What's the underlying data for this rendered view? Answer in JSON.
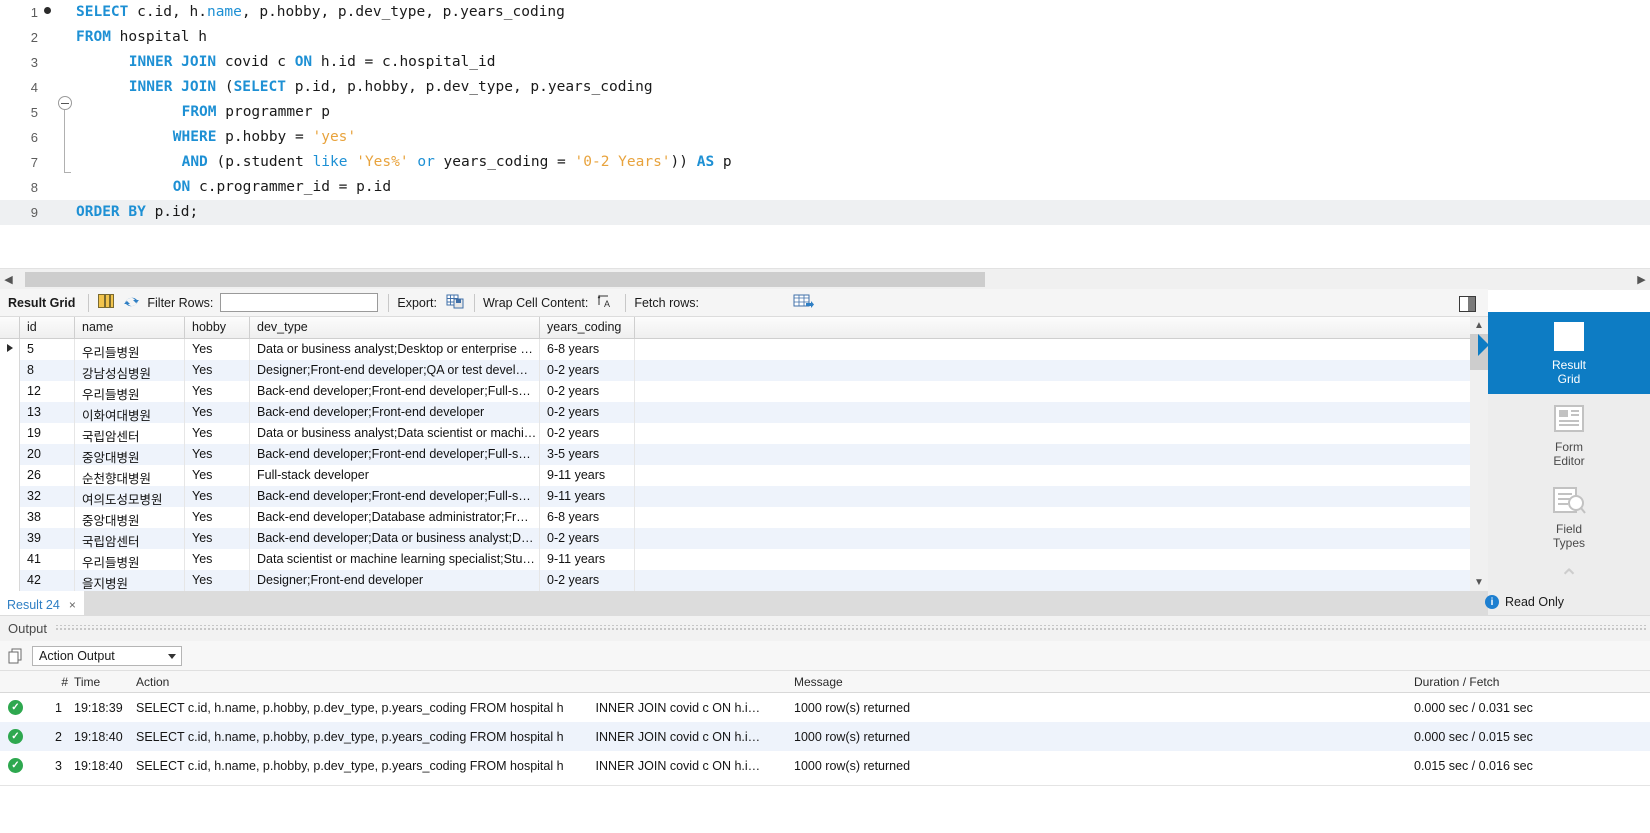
{
  "editor": {
    "lines": [
      {
        "num": "1",
        "breakpoint": true,
        "indent": 0,
        "tokens": [
          {
            "t": "SELECT",
            "c": "kw"
          },
          {
            "t": " c.id, h.",
            "c": "pl"
          },
          {
            "t": "name",
            "c": "kw2"
          },
          {
            "t": ", p.hobby, p.dev_type, p.years_coding",
            "c": "pl"
          }
        ]
      },
      {
        "num": "2",
        "breakpoint": false,
        "indent": 0,
        "tokens": [
          {
            "t": "FROM",
            "c": "kw"
          },
          {
            "t": " hospital h",
            "c": "pl"
          }
        ]
      },
      {
        "num": "3",
        "breakpoint": false,
        "indent": 6,
        "tokens": [
          {
            "t": "INNER JOIN",
            "c": "kw"
          },
          {
            "t": " covid c ",
            "c": "pl"
          },
          {
            "t": "ON",
            "c": "kw"
          },
          {
            "t": " h.id = c.hospital_id",
            "c": "pl"
          }
        ]
      },
      {
        "num": "4",
        "breakpoint": false,
        "indent": 6,
        "fold": true,
        "tokens": [
          {
            "t": "INNER JOIN",
            "c": "kw"
          },
          {
            "t": " (",
            "c": "pl"
          },
          {
            "t": "SELECT",
            "c": "kw"
          },
          {
            "t": " p.id, p.hobby, p.dev_type, p.years_coding",
            "c": "pl"
          }
        ]
      },
      {
        "num": "5",
        "breakpoint": false,
        "indent": 12,
        "tokens": [
          {
            "t": "FROM",
            "c": "kw"
          },
          {
            "t": " programmer p",
            "c": "pl"
          }
        ]
      },
      {
        "num": "6",
        "breakpoint": false,
        "indent": 11,
        "tokens": [
          {
            "t": "WHERE",
            "c": "kw"
          },
          {
            "t": " p.hobby = ",
            "c": "pl"
          },
          {
            "t": "'yes'",
            "c": "str"
          }
        ]
      },
      {
        "num": "7",
        "breakpoint": false,
        "indent": 12,
        "tokens": [
          {
            "t": "AND",
            "c": "kw"
          },
          {
            "t": " (p.student ",
            "c": "pl"
          },
          {
            "t": "like",
            "c": "kw2"
          },
          {
            "t": " ",
            "c": "pl"
          },
          {
            "t": "'Yes%'",
            "c": "str"
          },
          {
            "t": " ",
            "c": "pl"
          },
          {
            "t": "or",
            "c": "kw2"
          },
          {
            "t": " years_coding = ",
            "c": "pl"
          },
          {
            "t": "'0-2 Years'",
            "c": "str"
          },
          {
            "t": ")) ",
            "c": "pl"
          },
          {
            "t": "AS",
            "c": "kw"
          },
          {
            "t": " p",
            "c": "pl"
          }
        ]
      },
      {
        "num": "8",
        "breakpoint": false,
        "indent": 11,
        "tokens": [
          {
            "t": "ON",
            "c": "kw"
          },
          {
            "t": " c.programmer_id = p.id",
            "c": "pl"
          }
        ]
      },
      {
        "num": "9",
        "breakpoint": false,
        "indent": 0,
        "current": true,
        "tokens": [
          {
            "t": "ORDER BY",
            "c": "kw"
          },
          {
            "t": " p.id;",
            "c": "pl"
          }
        ]
      }
    ]
  },
  "result_toolbar": {
    "title": "Result Grid",
    "filter_label": "Filter Rows:",
    "filter_value": "",
    "export_label": "Export:",
    "wrap_label": "Wrap Cell Content:",
    "wrap_glyph": "↑A",
    "fetch_label": "Fetch rows:"
  },
  "grid": {
    "columns": [
      "id",
      "name",
      "hobby",
      "dev_type",
      "years_coding"
    ],
    "rows": [
      {
        "id": "5",
        "name": "우리들병원",
        "hobby": "Yes",
        "dev_type": "Data or business analyst;Desktop or enterprise …",
        "years_coding": "6-8 years",
        "selected": true
      },
      {
        "id": "8",
        "name": "강남성심병원",
        "hobby": "Yes",
        "dev_type": "Designer;Front-end developer;QA or test devel…",
        "years_coding": "0-2 years"
      },
      {
        "id": "12",
        "name": "우리들병원",
        "hobby": "Yes",
        "dev_type": "Back-end developer;Front-end developer;Full-s…",
        "years_coding": "0-2 years"
      },
      {
        "id": "13",
        "name": "이화여대병원",
        "hobby": "Yes",
        "dev_type": "Back-end developer;Front-end developer",
        "years_coding": "0-2 years"
      },
      {
        "id": "19",
        "name": "국립암센터",
        "hobby": "Yes",
        "dev_type": "Data or business analyst;Data scientist or machi…",
        "years_coding": "0-2 years"
      },
      {
        "id": "20",
        "name": "중앙대병원",
        "hobby": "Yes",
        "dev_type": "Back-end developer;Front-end developer;Full-s…",
        "years_coding": "3-5 years"
      },
      {
        "id": "26",
        "name": "순천향대병원",
        "hobby": "Yes",
        "dev_type": "Full-stack developer",
        "years_coding": "9-11 years"
      },
      {
        "id": "32",
        "name": "여의도성모병원",
        "hobby": "Yes",
        "dev_type": "Back-end developer;Front-end developer;Full-s…",
        "years_coding": "9-11 years"
      },
      {
        "id": "38",
        "name": "중앙대병원",
        "hobby": "Yes",
        "dev_type": "Back-end developer;Database administrator;Fr…",
        "years_coding": "6-8 years"
      },
      {
        "id": "39",
        "name": "국립암센터",
        "hobby": "Yes",
        "dev_type": "Back-end developer;Data or business analyst;D…",
        "years_coding": "0-2 years"
      },
      {
        "id": "41",
        "name": "우리들병원",
        "hobby": "Yes",
        "dev_type": "Data scientist or machine learning specialist;Stu…",
        "years_coding": "9-11 years"
      },
      {
        "id": "42",
        "name": "을지병원",
        "hobby": "Yes",
        "dev_type": "Designer;Front-end developer",
        "years_coding": "0-2 years"
      }
    ]
  },
  "side_panel": {
    "items": [
      {
        "label_line1": "Result",
        "label_line2": "Grid",
        "icon": "result-grid-icon",
        "active": true
      },
      {
        "label_line1": "Form",
        "label_line2": "Editor",
        "icon": "form-editor-icon",
        "active": false
      },
      {
        "label_line1": "Field",
        "label_line2": "Types",
        "icon": "field-types-icon",
        "active": false
      }
    ]
  },
  "result_tab": {
    "label": "Result 24",
    "close_glyph": "×",
    "read_only": "Read Only",
    "info_glyph": "i"
  },
  "output": {
    "title": "Output",
    "selector_value": "Action Output",
    "columns": [
      "#",
      "Time",
      "Action",
      "Message",
      "Duration / Fetch"
    ],
    "rows": [
      {
        "status": "success",
        "num": "1",
        "time": "19:18:39",
        "action": "SELECT c.id, h.name, p.hobby, p.dev_type, p.years_coding FROM hospital h",
        "action2": "INNER JOIN covid c ON h.i…",
        "message": "1000 row(s) returned",
        "duration": "0.000 sec / 0.031 sec"
      },
      {
        "status": "success",
        "num": "2",
        "time": "19:18:40",
        "action": "SELECT c.id, h.name, p.hobby, p.dev_type, p.years_coding FROM hospital h",
        "action2": "INNER JOIN covid c ON h.i…",
        "message": "1000 row(s) returned",
        "duration": "0.000 sec / 0.015 sec"
      },
      {
        "status": "success",
        "num": "3",
        "time": "19:18:40",
        "action": "SELECT c.id, h.name, p.hobby, p.dev_type, p.years_coding FROM hospital h",
        "action2": "INNER JOIN covid c ON h.i…",
        "message": "1000 row(s) returned",
        "duration": "0.015 sec / 0.016 sec"
      }
    ],
    "status_glyph": "✓"
  },
  "colors": {
    "accent": "#0d7cc4",
    "keyword": "#1e90d4",
    "string": "#e8a33d",
    "success": "#2ea84f",
    "alt_row": "#eef3fb"
  }
}
